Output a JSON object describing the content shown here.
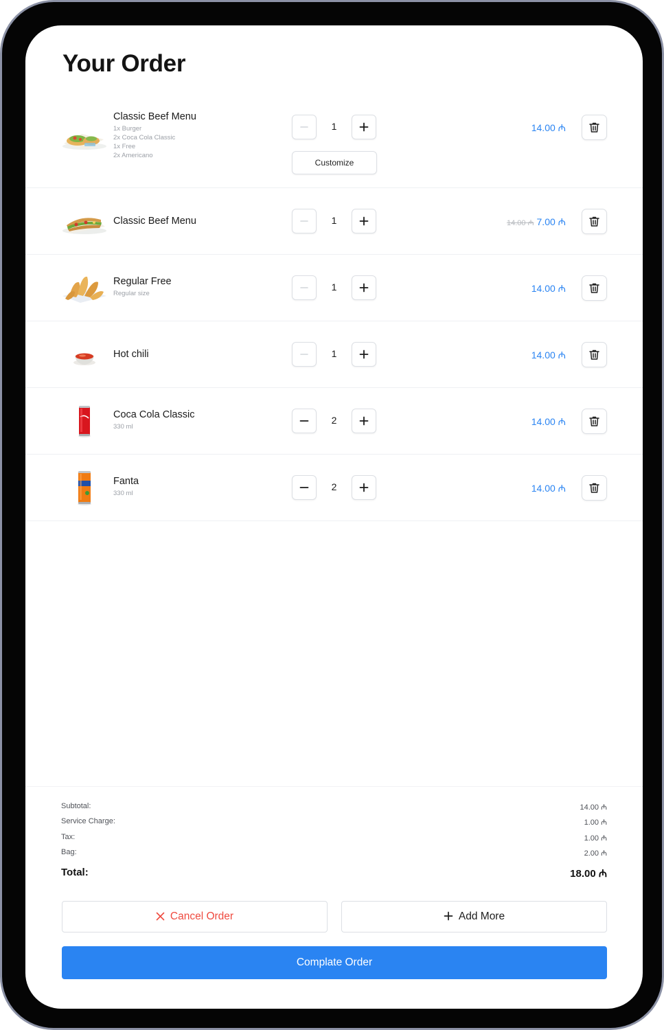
{
  "page": {
    "title": "Your Order"
  },
  "currency_symbol": "₼",
  "items": [
    {
      "name": "Classic Beef Menu",
      "details": [
        "1x Burger",
        "2x Coca Cola Classic",
        "1x Free",
        "2x Americano"
      ],
      "quantity": "1",
      "price": "14.00 ₼",
      "customize_label": "Customize",
      "image": "wrap-icon"
    },
    {
      "name": "Classic Beef Menu",
      "details": [],
      "quantity": "1",
      "old_price": "14.00 ₼",
      "price": "7.00 ₼",
      "image": "sandwich-icon"
    },
    {
      "name": "Regular Free",
      "details": [
        "Regular size"
      ],
      "quantity": "1",
      "price": "14.00 ₼",
      "image": "potato-wedges-icon"
    },
    {
      "name": "Hot chili",
      "details": [],
      "quantity": "1",
      "price": "14.00 ₼",
      "image": "chili-sauce-icon"
    },
    {
      "name": "Coca Cola Classic",
      "details": [
        "330 ml"
      ],
      "quantity": "2",
      "price": "14.00 ₼",
      "image": "coca-cola-can-icon"
    },
    {
      "name": "Fanta",
      "details": [
        "330 ml"
      ],
      "quantity": "2",
      "price": "14.00 ₼",
      "image": "fanta-can-icon"
    }
  ],
  "summary": {
    "subtotal_label": "Subtotal:",
    "subtotal_value": "14.00 ₼",
    "service_label": "Service Charge:",
    "service_value": "1.00 ₼",
    "tax_label": "Tax:",
    "tax_value": "1.00 ₼",
    "bag_label": "Bag:",
    "bag_value": "2.00 ₼",
    "total_label": "Total:",
    "total_value": "18.00 ₼"
  },
  "actions": {
    "cancel_label": "Cancel Order",
    "add_label": "Add More",
    "complete_label": "Complate Order"
  },
  "colors": {
    "accent": "#2a84f2",
    "danger": "#ef4a3f",
    "text": "#141414",
    "muted": "#9b9fa6",
    "disabled_icon": "#d2d5da"
  }
}
